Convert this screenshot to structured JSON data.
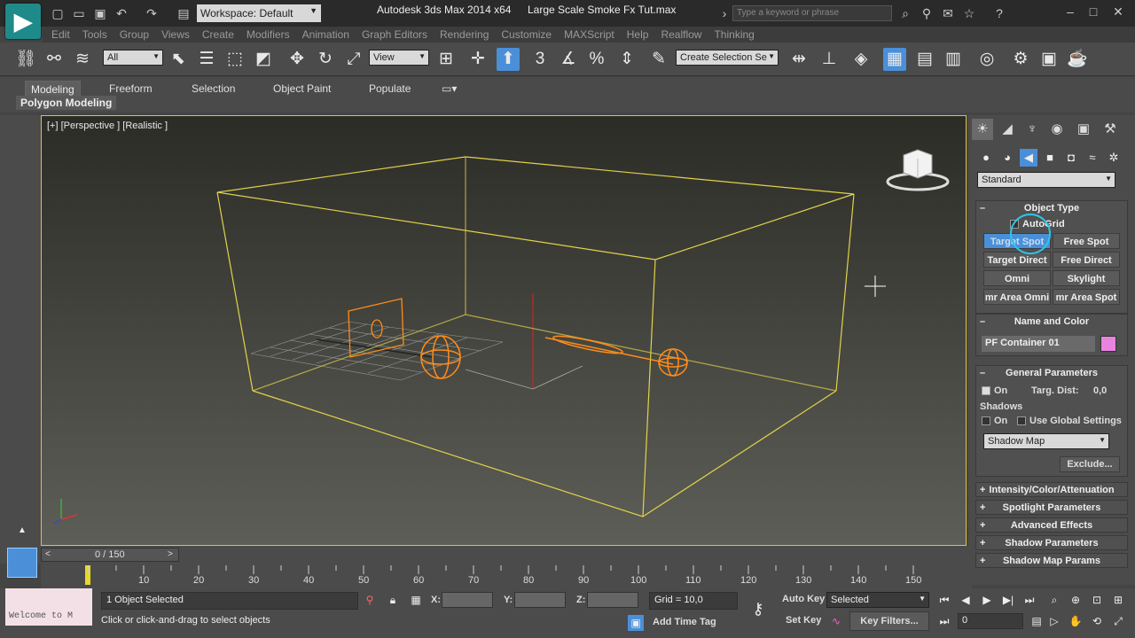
{
  "titlebar": {
    "workspace": "Workspace: Default",
    "app_title": "Autodesk 3ds Max  2014 x64",
    "file_title": "Large Scale Smoke Fx Tut.max",
    "search_placeholder": "Type a keyword or phrase"
  },
  "menubar": [
    "Edit",
    "Tools",
    "Group",
    "Views",
    "Create",
    "Modifiers",
    "Animation",
    "Graph Editors",
    "Rendering",
    "Customize",
    "MAXScript",
    "Help",
    "Realflow",
    "Thinking"
  ],
  "toolbar": {
    "filter": "All",
    "ref_coord": "View",
    "selection_set": "Create Selection Se",
    "snap_label": "3"
  },
  "ribbon": {
    "tabs": [
      "Modeling",
      "Freeform",
      "Selection",
      "Object Paint",
      "Populate"
    ],
    "panel": "Polygon Modeling"
  },
  "viewport": {
    "label": "[+] [Perspective ] [Realistic ]",
    "frame_color": "#e2c23a",
    "object_color": "#ff8c1a"
  },
  "command_panel": {
    "category": "Standard",
    "object_type": {
      "title": "Object Type",
      "autogrid": "AutoGrid",
      "buttons": [
        "Target Spot",
        "Free Spot",
        "Target Direct",
        "Free Direct",
        "Omni",
        "Skylight",
        "mr Area Omni",
        "mr Area Spot"
      ]
    },
    "name_color": {
      "title": "Name and Color",
      "name": "PF Container 01",
      "swatch": "#e884e0"
    },
    "general": {
      "title": "General Parameters",
      "on": "On",
      "targ_dist_label": "Targ. Dist:",
      "targ_dist": "0,0",
      "shadows": "Shadows",
      "shadows_on": "On",
      "use_global": "Use Global Settings",
      "shadow_type": "Shadow Map",
      "exclude": "Exclude..."
    },
    "collapsed": [
      "Intensity/Color/Attenuation",
      "Spotlight Parameters",
      "Advanced Effects",
      "Shadow Parameters",
      "Shadow Map Params"
    ]
  },
  "timeline": {
    "frame": "0 / 150",
    "ticks": [
      "10",
      "20",
      "30",
      "40",
      "50",
      "60",
      "70",
      "80",
      "90",
      "100",
      "110",
      "120",
      "130",
      "140",
      "150"
    ]
  },
  "status": {
    "maxscript": "Welcome to M",
    "selected": "1 Object Selected",
    "prompt": "Click or click-and-drag to select objects",
    "x_label": "X:",
    "y_label": "Y:",
    "z_label": "Z:",
    "grid": "Grid = 10,0",
    "add_time_tag": "Add Time Tag",
    "auto_key": "Auto Key",
    "set_key": "Set Key",
    "key_mode": "Selected",
    "key_filters": "Key Filters...",
    "current_frame": "0"
  }
}
